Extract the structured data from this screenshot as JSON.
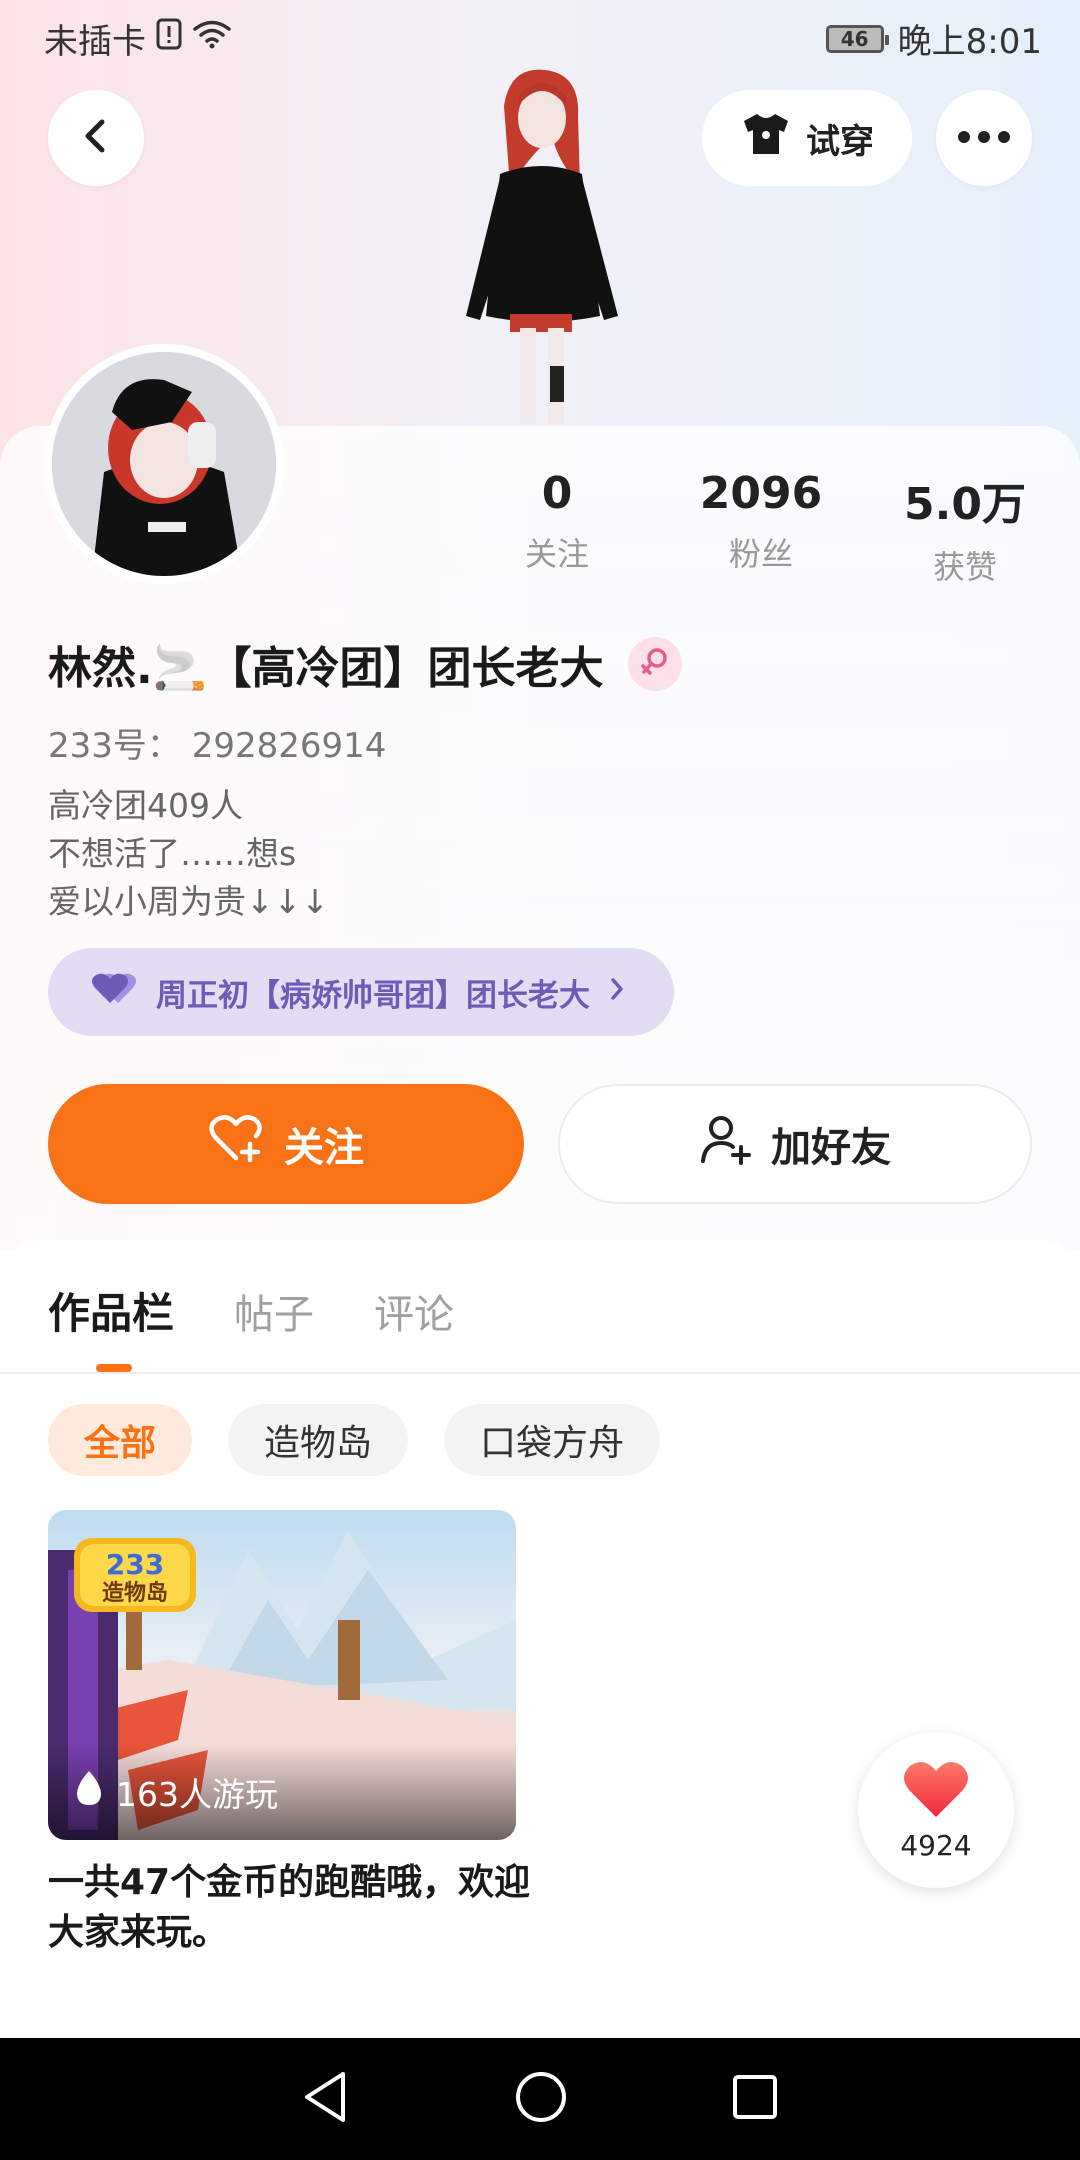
{
  "status_bar": {
    "carrier": "未插卡",
    "battery": "46",
    "time": "晚上8:01"
  },
  "header": {
    "try_on_label": "试穿"
  },
  "stats": [
    {
      "value": "0",
      "label": "关注"
    },
    {
      "value": "2096",
      "label": "粉丝"
    },
    {
      "value": "5.0万",
      "label": "获赞"
    }
  ],
  "profile": {
    "name": "林然.🚬【高冷团】团长老大",
    "uid": "233号：  292826914",
    "bio": [
      "高冷团409人",
      "不想活了……想s",
      "爱以小周为贵↓↓↓"
    ],
    "title_badge": "周正初【病娇帅哥团】团长老大"
  },
  "actions": {
    "follow_label": "关注",
    "add_friend_label": "加好友"
  },
  "tabs": [
    "作品栏",
    "帖子",
    "评论"
  ],
  "chips": [
    "全部",
    "造物岛",
    "口袋方舟"
  ],
  "work": {
    "badge": "233 造物岛",
    "plays": "163人游玩",
    "title": "一共47个金币的跑酷哦，欢迎大家来玩。"
  },
  "likes": {
    "count": "4924"
  },
  "colors": {
    "accent": "#f97316",
    "title_badge_bg": "#e4dcf3",
    "title_badge_text": "#6d5bb8"
  }
}
